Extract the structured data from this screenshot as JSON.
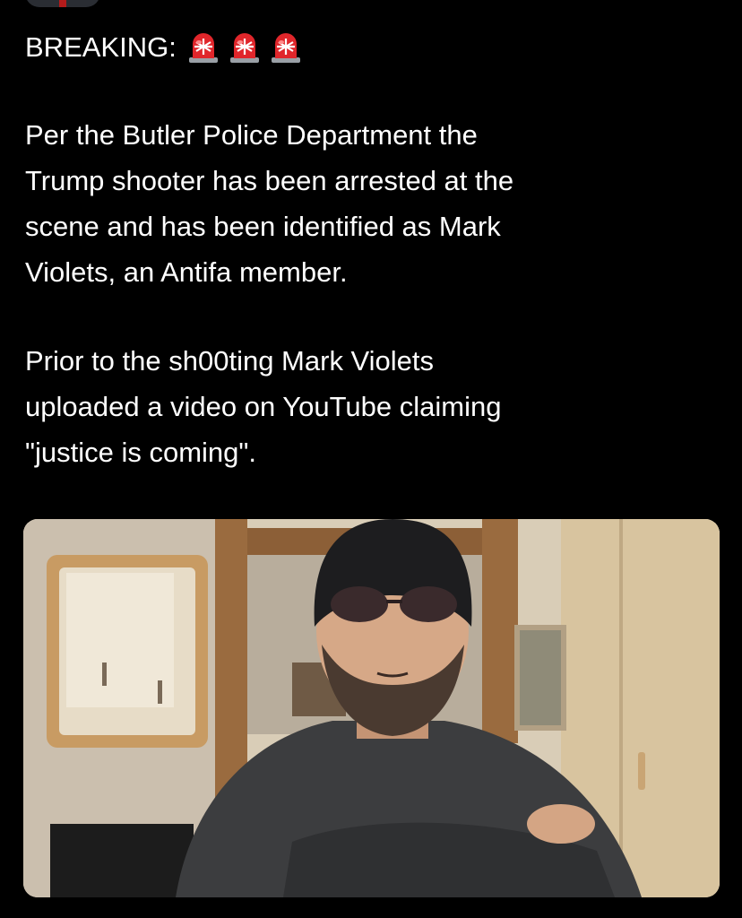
{
  "post": {
    "breaking_label": "BREAKING:",
    "siren_icons": [
      "rotating-light-icon",
      "rotating-light-icon",
      "rotating-light-icon"
    ],
    "paragraph_1": "Per the Butler Police Department the\nTrump shooter has been arrested at the\nscene and has been identified as Mark\nViolets, an Antifa member.",
    "paragraph_2": "Prior to the sh00ting Mark Violets\nuploaded a video on YouTube claiming\n\"justice is coming\"."
  },
  "colors": {
    "background": "#000000",
    "text": "#ffffff",
    "siren_red": "#e0262b"
  }
}
